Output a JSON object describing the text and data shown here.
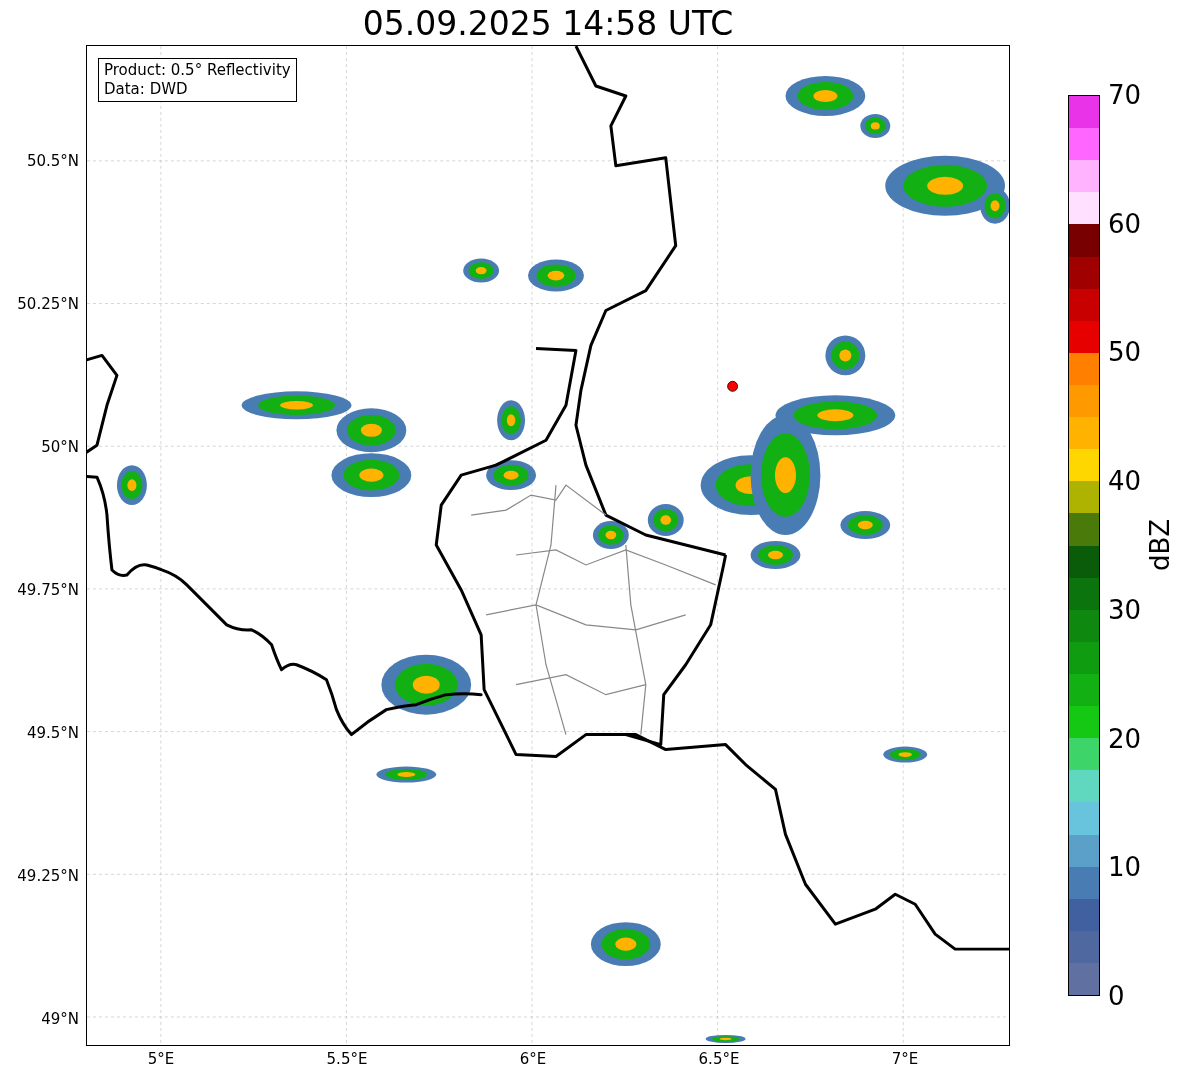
{
  "title": "05.09.2025 14:58 UTC",
  "legend": {
    "lines": [
      "Product: 0.5° Reflectivity",
      "Data: DWD"
    ]
  },
  "map": {
    "lat_ticks": [
      "50.5°N",
      "50.25°N",
      "50°N",
      "49.75°N",
      "49.5°N",
      "49.25°N",
      "49°N"
    ],
    "lon_ticks": [
      "5°E",
      "5.5°E",
      "6°E",
      "6.5°E",
      "7°E"
    ]
  },
  "colorbar": {
    "label": "dBZ",
    "ticks": [
      "70",
      "60",
      "50",
      "40",
      "30",
      "20",
      "10",
      "0"
    ],
    "segments": [
      {
        "color": "#e833e8"
      },
      {
        "color": "#ff66ff"
      },
      {
        "color": "#ffb3ff"
      },
      {
        "color": "#ffe0ff"
      },
      {
        "color": "#780000"
      },
      {
        "color": "#a00000"
      },
      {
        "color": "#c80000"
      },
      {
        "color": "#e60000"
      },
      {
        "color": "#ff7f00"
      },
      {
        "color": "#ff9900"
      },
      {
        "color": "#ffb300"
      },
      {
        "color": "#ffd700"
      },
      {
        "color": "#adb300"
      },
      {
        "color": "#4a7a0a"
      },
      {
        "color": "#0a5c0a"
      },
      {
        "color": "#0c740c"
      },
      {
        "color": "#0e880e"
      },
      {
        "color": "#109c10"
      },
      {
        "color": "#12b012"
      },
      {
        "color": "#14c814"
      },
      {
        "color": "#3dd46a"
      },
      {
        "color": "#60d8c0"
      },
      {
        "color": "#68c4dc"
      },
      {
        "color": "#5aa0c8"
      },
      {
        "color": "#4a7cb4"
      },
      {
        "color": "#4060a0"
      },
      {
        "color": "#5068a0"
      },
      {
        "color": "#6070a0"
      }
    ]
  }
}
